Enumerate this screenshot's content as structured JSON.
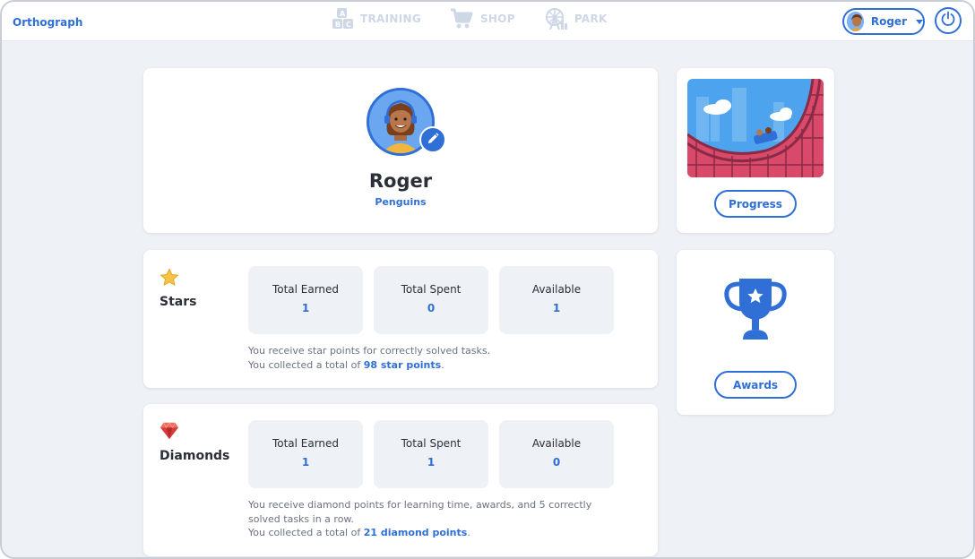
{
  "app": {
    "brand": "Orthograph"
  },
  "nav": [
    {
      "label": "TRAINING",
      "icon": "abc-blocks-icon"
    },
    {
      "label": "SHOP",
      "icon": "cart-icon"
    },
    {
      "label": "PARK",
      "icon": "ferris-wheel-icon"
    }
  ],
  "user_menu": {
    "name": "Roger"
  },
  "profile": {
    "name": "Roger",
    "team": "Penguins"
  },
  "stars": {
    "title": "Stars",
    "earned_label": "Total Earned",
    "earned": "1",
    "spent_label": "Total Spent",
    "spent": "0",
    "available_label": "Available",
    "available": "1",
    "desc_line1": "You receive star points for correctly solved tasks.",
    "desc_prefix": "You collected a total of ",
    "desc_points": "98 star points",
    "desc_suffix": "."
  },
  "diamonds": {
    "title": "Diamonds",
    "earned_label": "Total Earned",
    "earned": "1",
    "spent_label": "Total Spent",
    "spent": "1",
    "available_label": "Available",
    "available": "0",
    "desc_line1": "You receive diamond points for learning time, awards, and 5 correctly solved tasks in a row.",
    "desc_prefix": "You collected a total of ",
    "desc_points": "21 diamond points",
    "desc_suffix": "."
  },
  "side": {
    "progress_label": "Progress",
    "awards_label": "Awards"
  },
  "colors": {
    "accent": "#2f6fd6",
    "nav_inactive": "#cdd7e6",
    "background": "#eef1f5"
  }
}
